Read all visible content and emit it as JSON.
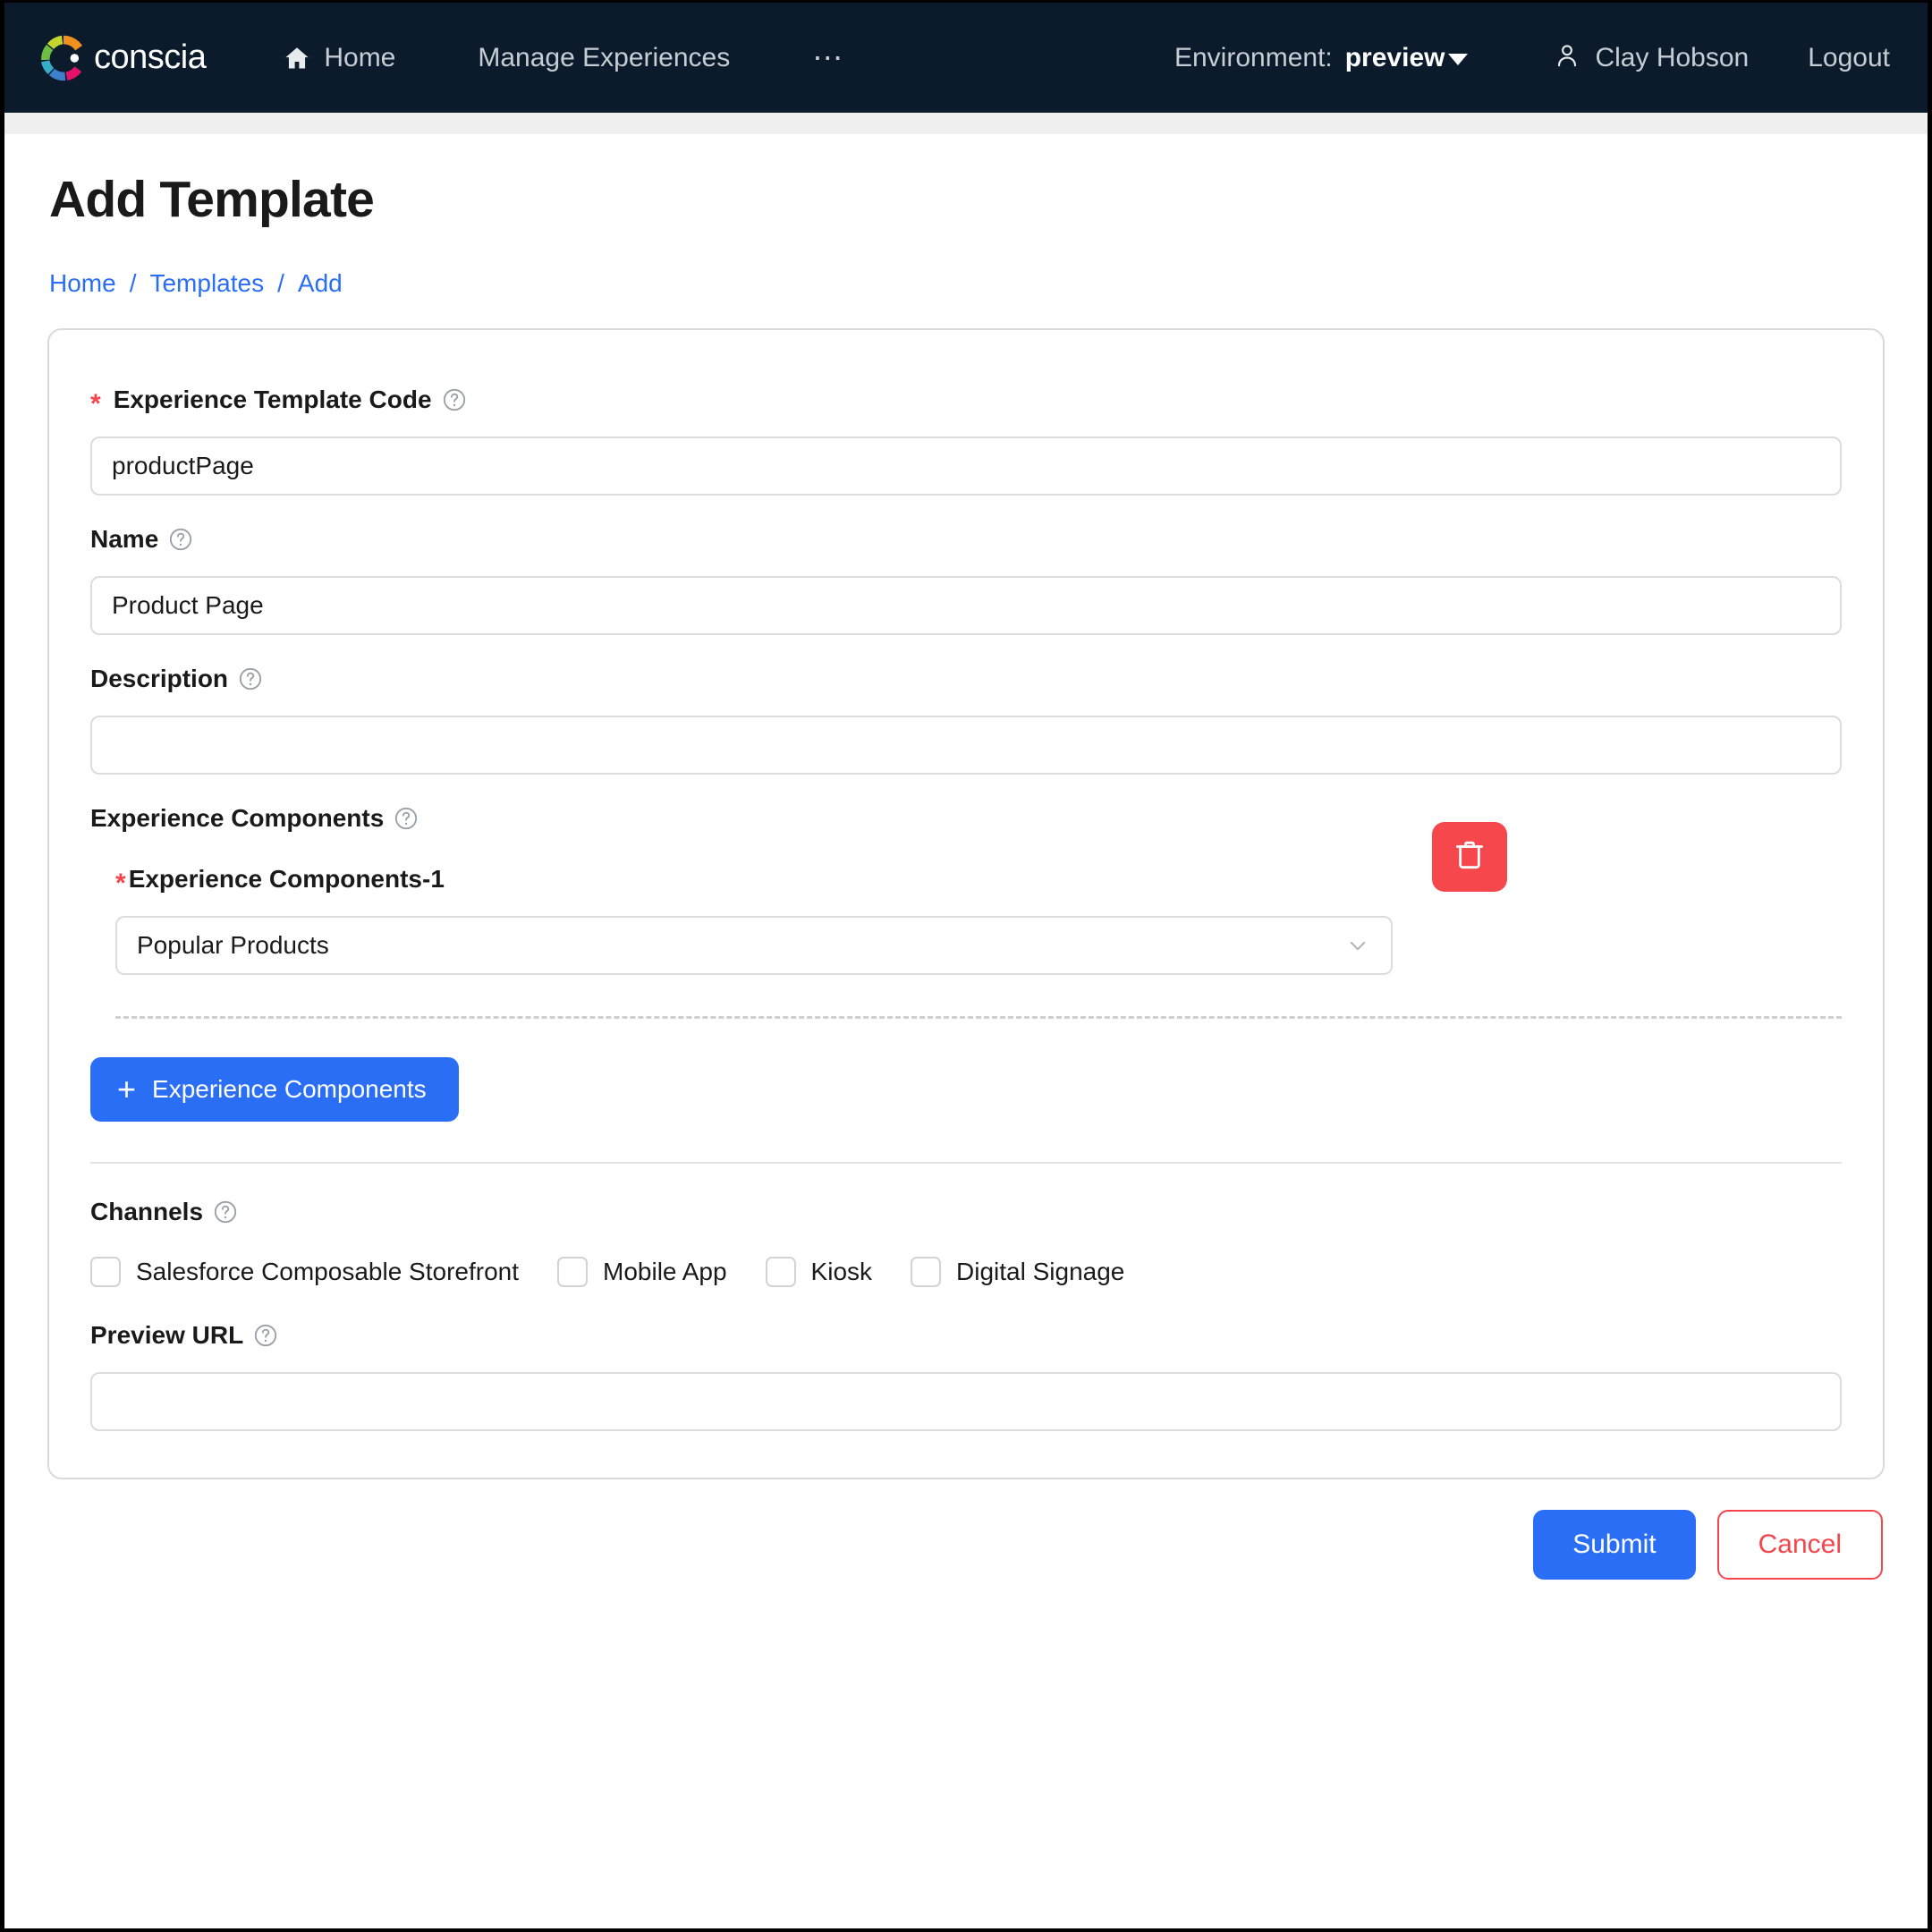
{
  "navbar": {
    "brand_name": "conscia",
    "logo_icon": "conscia-ring-logo",
    "links": [
      {
        "label": "Home",
        "icon": "home-icon"
      },
      {
        "label": "Manage Experiences",
        "icon": ""
      },
      {
        "label": "⋯",
        "icon": "ellipsis-icon"
      }
    ],
    "environment_label": "Environment:",
    "environment_value": "preview",
    "user_icon": "user-icon",
    "user_name": "Clay Hobson",
    "logout_label": "Logout"
  },
  "header": {
    "title": "Add Template",
    "breadcrumb": [
      {
        "label": "Home"
      },
      {
        "label": "Templates"
      },
      {
        "label": "Add"
      }
    ],
    "breadcrumb_separator": "/"
  },
  "form": {
    "template_code": {
      "label": "Experience Template Code",
      "required_marker": "*",
      "help_icon": "help-circle-icon",
      "value": "productPage",
      "placeholder": ""
    },
    "name": {
      "label": "Name",
      "help_icon": "help-circle-icon",
      "value": "Product Page",
      "placeholder": ""
    },
    "description": {
      "label": "Description",
      "help_icon": "help-circle-icon",
      "value": "",
      "placeholder": ""
    },
    "experience_components": {
      "label": "Experience Components",
      "help_icon": "help-circle-icon",
      "items": [
        {
          "label": "Experience Components-1",
          "required_marker": "*",
          "selected": "Popular Products",
          "chevron_icon": "chevron-down-icon",
          "delete_icon": "trash-icon"
        }
      ],
      "add_button_label": "Experience Components",
      "add_button_icon": "plus-icon"
    },
    "channels": {
      "label": "Channels",
      "help_icon": "help-circle-icon",
      "options": [
        {
          "label": "Salesforce Composable Storefront",
          "checked": false
        },
        {
          "label": "Mobile App",
          "checked": false
        },
        {
          "label": "Kiosk",
          "checked": false
        },
        {
          "label": "Digital Signage",
          "checked": false
        }
      ]
    },
    "preview_url": {
      "label": "Preview URL",
      "help_icon": "help-circle-icon",
      "value": "",
      "placeholder": ""
    }
  },
  "actions": {
    "submit_label": "Submit",
    "cancel_label": "Cancel"
  },
  "colors": {
    "navbar_bg": "#0B1B2B",
    "accent_blue": "#2B6EF6",
    "danger_red": "#F5454C",
    "link_blue": "#2B6EF6",
    "border_gray": "#DCDCDC"
  }
}
